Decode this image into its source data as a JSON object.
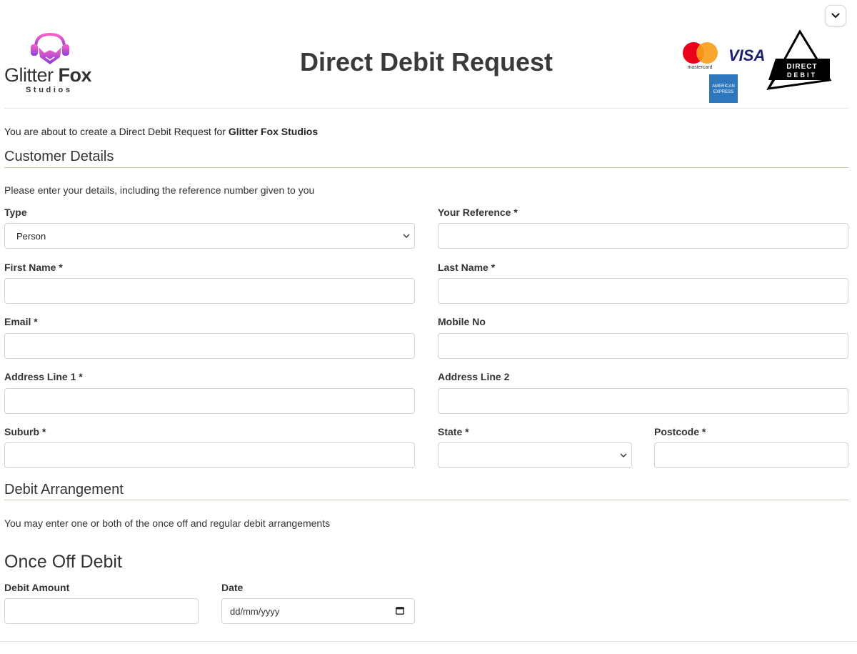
{
  "header": {
    "logo_main": "Glitter",
    "logo_bold": "Fox",
    "logo_sub": "Studios",
    "title": "Direct Debit Request",
    "payment_logos": {
      "mastercard": "mastercard",
      "visa": "VISA",
      "amex_line1": "AMERICAN",
      "amex_line2": "EXPRESS",
      "direct_debit_line1": "DIRECT",
      "direct_debit_line2": "DEBIT"
    }
  },
  "intro": {
    "prefix": "You are about to create a Direct Debit Request for ",
    "company": "Glitter Fox Studios"
  },
  "customer_details": {
    "title": "Customer Details",
    "helper": "Please enter your details, including the reference number given to you",
    "fields": {
      "type": {
        "label": "Type",
        "value": "Person"
      },
      "reference": {
        "label": "Your Reference *",
        "value": ""
      },
      "first_name": {
        "label": "First Name *",
        "value": ""
      },
      "last_name": {
        "label": "Last Name *",
        "value": ""
      },
      "email": {
        "label": "Email *",
        "value": ""
      },
      "mobile": {
        "label": "Mobile No",
        "value": ""
      },
      "address1": {
        "label": "Address Line 1 *",
        "value": ""
      },
      "address2": {
        "label": "Address Line 2",
        "value": ""
      },
      "suburb": {
        "label": "Suburb *",
        "value": ""
      },
      "state": {
        "label": "State *",
        "value": ""
      },
      "postcode": {
        "label": "Postcode *",
        "value": ""
      }
    }
  },
  "debit_arrangement": {
    "title": "Debit Arrangement",
    "helper": "You may enter one or both of the once off and regular debit arrangements",
    "once_off": {
      "title": "Once Off Debit",
      "amount_label": "Debit Amount",
      "amount_value": "",
      "date_label": "Date",
      "date_placeholder": "dd/mm/yyyy"
    }
  },
  "colors": {
    "section_line": "#b7cc9e",
    "fox_gradient_top": "#ff5fc8",
    "fox_gradient_bottom": "#8a3fd6",
    "visa": "#1a1f71",
    "amex": "#2e77bc"
  },
  "icons": {
    "collapse": "chevron-down-icon",
    "select": "chevron-down-icon",
    "calendar": "calendar-icon"
  }
}
